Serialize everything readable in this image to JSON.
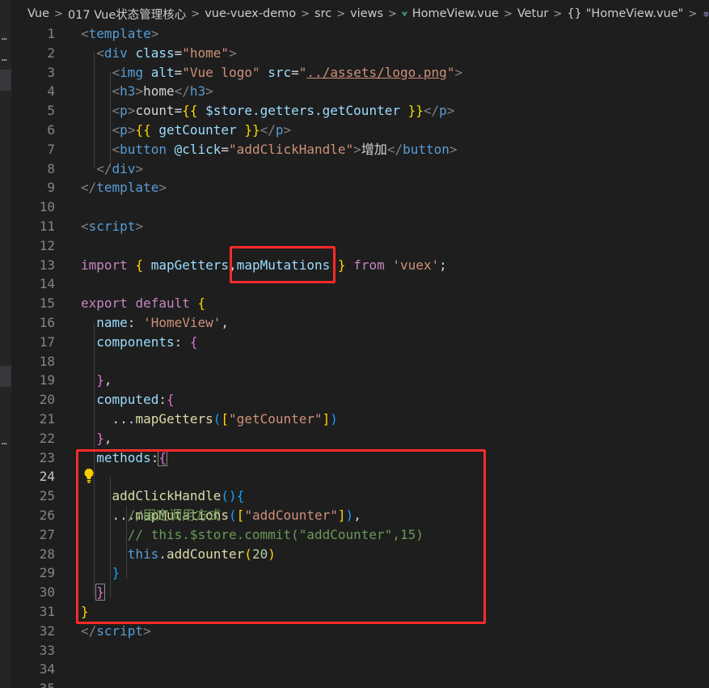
{
  "breadcrumb": {
    "items": [
      "Vue",
      "017 Vue状态管理核心",
      "vue-vuex-demo",
      "src",
      "views",
      "HomeView.vue",
      "Vetur",
      "\"HomeView.vue\""
    ],
    "separator": ">",
    "brace_glyph": "{}"
  },
  "editor": {
    "active_line": 24,
    "lines": [
      {
        "n": "1"
      },
      {
        "n": "2"
      },
      {
        "n": "3"
      },
      {
        "n": "4"
      },
      {
        "n": "5"
      },
      {
        "n": "6"
      },
      {
        "n": "7"
      },
      {
        "n": "8"
      },
      {
        "n": "9"
      },
      {
        "n": "10"
      },
      {
        "n": "11"
      },
      {
        "n": "12"
      },
      {
        "n": "13"
      },
      {
        "n": "14"
      },
      {
        "n": "15"
      },
      {
        "n": "16"
      },
      {
        "n": "17"
      },
      {
        "n": "18"
      },
      {
        "n": "19"
      },
      {
        "n": "20"
      },
      {
        "n": "21"
      },
      {
        "n": "22"
      },
      {
        "n": "23"
      },
      {
        "n": "24"
      },
      {
        "n": "25"
      },
      {
        "n": "26"
      },
      {
        "n": "27"
      },
      {
        "n": "28"
      },
      {
        "n": "29"
      },
      {
        "n": "30"
      },
      {
        "n": "31"
      },
      {
        "n": "32"
      },
      {
        "n": "33"
      },
      {
        "n": "34"
      },
      {
        "n": "35"
      }
    ],
    "code": {
      "l1_tag": "template",
      "l2_tag": "div",
      "l2_attr": "class",
      "l2_val": "\"home\"",
      "l3_tag": "img",
      "l3_attr1": "alt",
      "l3_val1": "\"Vue logo\"",
      "l3_attr2": "src",
      "l3_val2_q": "\"",
      "l3_val2_link": "../assets/logo.png",
      "l3_val2_q2": "\"",
      "l4_tag": "h3",
      "l4_text": "home",
      "l5_tag": "p",
      "l5_text": "count=",
      "l5_open": "{{",
      "l5_expr": " $store.getters.getCounter ",
      "l5_close": "}}",
      "l6_tag": "p",
      "l6_open": "{{",
      "l6_expr": " getCounter ",
      "l6_close": "}}",
      "l7_tag": "button",
      "l7_attr": "@click",
      "l7_val": "\"addClickHandle\"",
      "l7_text": "增加",
      "l8_tag": "div",
      "l9_tag": "template",
      "l11_tag": "script",
      "l13_import": "import",
      "l13_open": "{",
      "l13_a": " mapGetters",
      "l13_comma": ",",
      "l13_b": "mapMutations",
      "l13_close": "}",
      "l13_from": "from",
      "l13_str": "'vuex'",
      "l13_semi": ";",
      "l15_export": "export",
      "l15_default": "default",
      "l15_brace": "{",
      "l16_key": "name",
      "l16_str": "'HomeView'",
      "l16_tail": ",",
      "l17_key": "components",
      "l17_brace": "{",
      "l19_brace": "}",
      "l19_tail": ",",
      "l20_key": "computed",
      "l20_brace": "{",
      "l21_spread": "...",
      "l21_fn": "mapGetters",
      "l21_paren": "(",
      "l21_br": "[",
      "l21_str": "\"getCounter\"",
      "l21_br2": "]",
      "l21_paren2": ")",
      "l22_brace": "}",
      "l22_tail": ",",
      "l23_key": "methods",
      "l23_brace": "{",
      "l24_spread": "...",
      "l24_fn": "mapMutations",
      "l24_paren": "(",
      "l24_br": "[",
      "l24_str": "\"addCounter\"",
      "l24_br2": "]",
      "l24_paren2": ")",
      "l24_tail": ",",
      "l25_fn": "addClickHandle",
      "l25_paren": "()",
      "l25_brace": "{",
      "l26_cm": "//固定调用方式",
      "l27_cm": "// this.$store.commit(\"addCounter\",15)",
      "l28_this": "this",
      "l28_dot": ".",
      "l28_fn": "addCounter",
      "l28_paren": "(",
      "l28_num": "20",
      "l28_paren2": ")",
      "l29_brace": "}",
      "l30_brace": "}",
      "l31_brace": "}",
      "l32_tag": "script"
    }
  },
  "colors": {
    "background": "#1e1e1e",
    "highlight_box": "#ff2a2a",
    "tag": "#569cd6",
    "attribute": "#9cdcfe",
    "string": "#ce9178",
    "comment": "#6a9955",
    "keyword": "#c586c0",
    "function": "#dcdcaa",
    "number": "#b5cea8"
  },
  "icons": [
    "vue-icon",
    "brace-icon",
    "cube-icon",
    "lightbulb-icon"
  ]
}
